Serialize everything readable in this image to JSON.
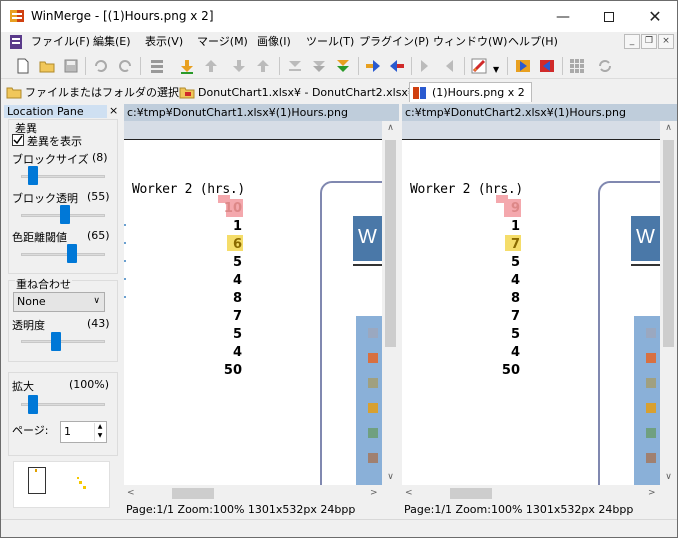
{
  "window": {
    "title": "WinMerge - [(1)Hours.png x 2]",
    "minimize_icon": "minimize-icon",
    "maximize_icon": "maximize-icon",
    "close_icon": "close-icon"
  },
  "menu": [
    "ファイル(F)",
    "編集(E)",
    "表示(V)",
    "マージ(M)",
    "画像(I)",
    "ツール(T)",
    "プラグイン(P)",
    "ウィンドウ(W)",
    "ヘルプ(H)"
  ],
  "tabs": [
    {
      "label": "ファイルまたはフォルダの選択...",
      "icon": "open-folder-icon"
    },
    {
      "label": "DonutChart1.xlsx¥ - DonutChart2.xlsx¥",
      "icon": "folder-compare-icon"
    },
    {
      "label": "(1)Hours.png x 2",
      "icon": "image-compare-icon"
    }
  ],
  "location_pane": {
    "title": "Location Pane",
    "close": "×",
    "diff_group": "差異",
    "show_diff": "差異を表示",
    "block_size_label": "ブロックサイズ",
    "block_size_value": "(8)",
    "block_alpha_label": "ブロック透明",
    "block_alpha_value": "(55)",
    "color_threshold_label": "色距離閾値",
    "color_threshold_value": "(65)",
    "overlay_group": "重ね合わせ",
    "overlay_mode": "None",
    "opacity_label": "透明度",
    "opacity_value": "(43)",
    "zoom_label": "拡大",
    "zoom_value": "(100%)",
    "page_label": "ページ:",
    "page_value": "1"
  },
  "left_pane": {
    "path": "c:¥tmp¥DonutChart1.xlsx¥(1)Hours.png",
    "heading": "Worker 2 (hrs.)",
    "values": [
      "10",
      "1",
      "6",
      "5",
      "4",
      "8",
      "7",
      "5",
      "4",
      "50"
    ],
    "status": "Page:1/1 Zoom:100% 1301x532px 24bpp"
  },
  "right_pane": {
    "path": "c:¥tmp¥DonutChart2.xlsx¥(1)Hours.png",
    "heading": "Worker 2 (hrs.)",
    "values": [
      "9",
      "1",
      "7",
      "5",
      "4",
      "8",
      "7",
      "5",
      "4",
      "50"
    ],
    "status": "Page:1/1 Zoom:100% 1301x532px 24bpp"
  },
  "colors": {
    "diff_red": "#f4a8ad",
    "diff_yellow": "#f5dd6a",
    "thumb_blue": "#0078d7",
    "pane_header": "#bfcddb"
  }
}
